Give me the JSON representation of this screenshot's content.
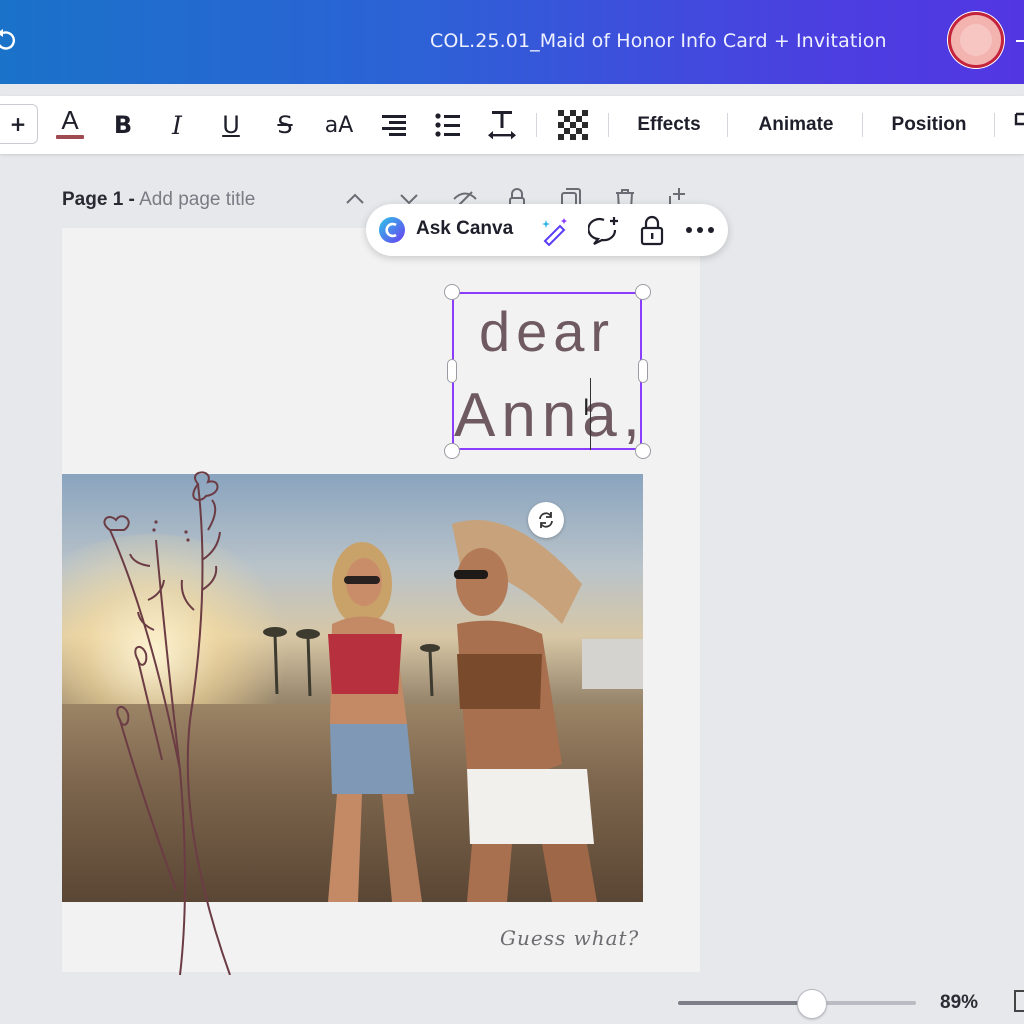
{
  "header": {
    "doc_title": "COL.25.01_Maid of Honor Info Card + Invitation",
    "icons": [
      "sync-icon",
      "avatar"
    ]
  },
  "toolbar": {
    "font_size_plus": "+",
    "text_color_glyph": "A",
    "bold_glyph": "B",
    "italic_glyph": "I",
    "underline_glyph": "U",
    "strike_glyph": "S",
    "case_glyph": "aA",
    "effects_label": "Effects",
    "animate_label": "Animate",
    "position_label": "Position",
    "text_color_underline": "#a04a52"
  },
  "page_header": {
    "page_label": "Page 1 -",
    "page_title_placeholder": "Add page title"
  },
  "context_bar": {
    "ask_label": "Ask Canva"
  },
  "card": {
    "greeting": "dear",
    "name": "Anna,",
    "script_line": "Guess what?",
    "text_color": "#6e5a60",
    "selection_color": "#8b3dff"
  },
  "footer": {
    "zoom_label": "89%",
    "zoom_value": 0.56
  }
}
